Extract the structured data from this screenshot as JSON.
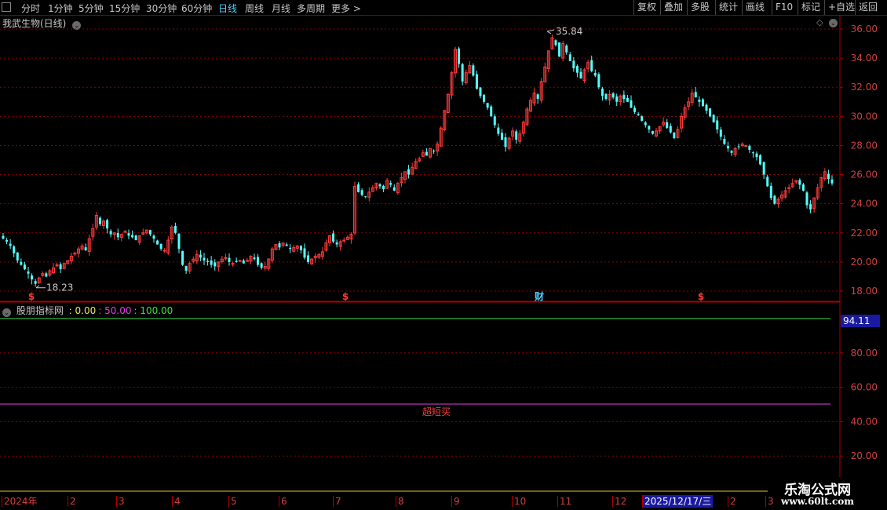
{
  "toolbar": {
    "periods": [
      "分时",
      "1分钟",
      "5分钟",
      "15分钟",
      "30分钟",
      "60分钟",
      "日线",
      "周线",
      "月线",
      "多周期",
      "更多"
    ],
    "active_period": "日线",
    "more_arrow": ">",
    "right_buttons": [
      "复权",
      "叠加",
      "多股",
      "统计",
      "画线",
      "F10",
      "标记",
      "+自选",
      "返回"
    ]
  },
  "stock": {
    "title": "我武生物(日线)"
  },
  "price_axis": {
    "labels": [
      "36.00",
      "34.00",
      "32.00",
      "30.00",
      "28.00",
      "26.00",
      "24.00",
      "22.00",
      "20.00",
      "18.00"
    ],
    "high_label": "35.84",
    "low_label": "18.23"
  },
  "markers": [
    "$",
    "$",
    "财",
    "$"
  ],
  "indicator": {
    "name": "股朋指标网",
    "values": [
      {
        "text": ": 0.00",
        "color": "#e8e86a"
      },
      {
        "text": ": 50.00",
        "color": "#e040e0"
      },
      {
        "text": ": 100.00",
        "color": "#40e040"
      }
    ],
    "current_value": "94.11",
    "axis_labels": [
      "80.00",
      "60.00",
      "40.00",
      "20.00"
    ],
    "zone_label": "超短买"
  },
  "date_axis": {
    "labels": [
      "2024年",
      "2",
      "3",
      "4",
      "5",
      "6",
      "7",
      "8",
      "9",
      "10",
      "11",
      "12",
      "2025/12/17/三",
      "2",
      "3"
    ]
  },
  "watermark": {
    "title": "乐淘公式网",
    "url": "www.60lt.com"
  },
  "colors": {
    "up": "#ff3b3b",
    "down": "#54ffff",
    "grid": "#8a0000",
    "accent": "#4fd0ff"
  },
  "chart_data": {
    "type": "candlestick",
    "ylim": [
      17.5,
      36.6
    ],
    "high": 35.84,
    "low": 18.23,
    "closes": [
      21.6,
      21.4,
      21.1,
      20.6,
      20.1,
      19.8,
      19.5,
      19.2,
      18.8,
      18.5,
      18.9,
      19.2,
      19.0,
      19.4,
      19.6,
      19.8,
      19.5,
      19.9,
      20.1,
      20.4,
      20.6,
      20.9,
      21.1,
      20.8,
      21.6,
      22.3,
      23.2,
      22.6,
      22.8,
      22.3,
      21.9,
      22.0,
      21.7,
      21.9,
      22.1,
      21.8,
      21.7,
      21.5,
      21.8,
      22.0,
      22.2,
      21.9,
      21.6,
      21.2,
      20.9,
      20.8,
      21.5,
      22.4,
      22.0,
      20.9,
      19.8,
      19.4,
      19.9,
      20.2,
      20.5,
      20.3,
      20.1,
      20.0,
      19.8,
      19.7,
      20.0,
      20.2,
      20.3,
      20.0,
      19.9,
      20.0,
      20.1,
      19.9,
      20.1,
      20.4,
      20.2,
      19.8,
      19.6,
      19.7,
      20.2,
      20.9,
      21.2,
      21.0,
      21.3,
      21.1,
      20.9,
      21.0,
      21.1,
      20.8,
      20.3,
      20.0,
      20.2,
      20.4,
      20.5,
      20.7,
      21.3,
      21.8,
      21.4,
      21.2,
      21.4,
      21.5,
      21.7,
      21.9,
      25.2,
      24.8,
      24.6,
      24.5,
      24.8,
      25.1,
      25.4,
      25.2,
      25.0,
      25.6,
      25.3,
      24.9,
      25.4,
      25.8,
      26.2,
      26.0,
      26.5,
      26.9,
      27.1,
      27.5,
      27.3,
      27.8,
      27.6,
      28.1,
      29.2,
      30.4,
      31.5,
      33.0,
      34.6,
      33.6,
      32.4,
      33.0,
      33.5,
      32.8,
      31.9,
      31.4,
      31.0,
      30.6,
      30.0,
      29.4,
      28.8,
      28.4,
      27.9,
      28.5,
      29.0,
      28.4,
      28.8,
      29.6,
      30.5,
      31.1,
      31.6,
      31.2,
      32.4,
      33.4,
      34.5,
      35.4,
      34.9,
      34.1,
      35.0,
      34.4,
      33.8,
      33.3,
      33.0,
      32.6,
      33.2,
      33.7,
      33.1,
      32.8,
      32.0,
      31.4,
      31.2,
      31.5,
      31.3,
      31.0,
      31.4,
      31.2,
      31.0,
      30.6,
      30.3,
      30.1,
      29.7,
      29.4,
      29.1,
      28.8,
      29.0,
      29.3,
      29.6,
      29.2,
      28.9,
      28.5,
      29.1,
      30.0,
      30.6,
      31.0,
      31.6,
      31.3,
      31.0,
      30.7,
      30.4,
      30.0,
      29.6,
      29.1,
      28.6,
      28.1,
      27.8,
      27.5,
      27.8,
      27.9,
      28.1,
      28.0,
      27.7,
      27.5,
      27.2,
      26.7,
      26.0,
      25.2,
      24.4,
      24.0,
      24.3,
      24.6,
      24.9,
      25.1,
      25.4,
      25.6,
      25.3,
      24.9,
      23.9,
      23.6,
      24.4,
      25.1,
      25.8,
      26.2,
      25.7,
      25.4
    ]
  }
}
